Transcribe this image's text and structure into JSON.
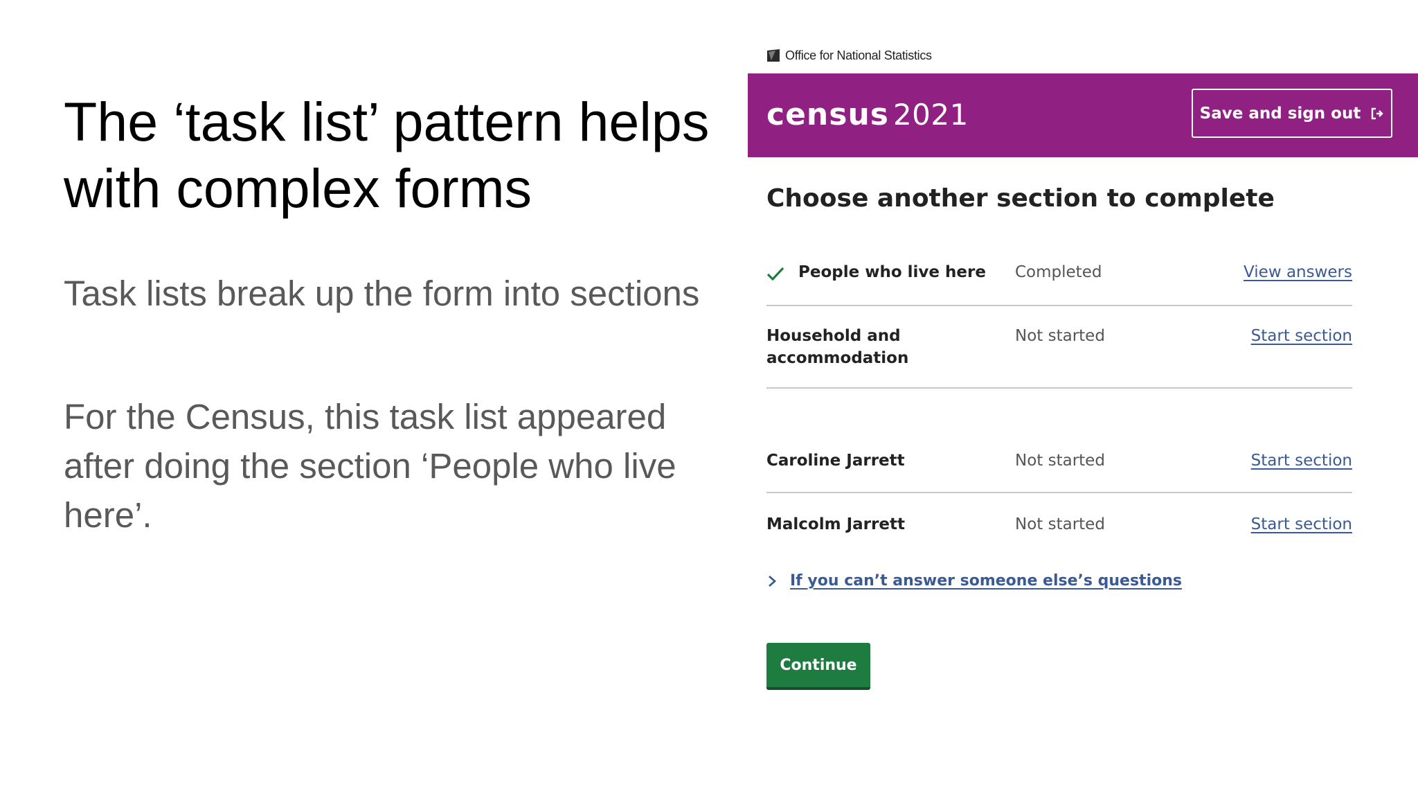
{
  "slide": {
    "title": "The ‘task list’ pattern helps with complex forms",
    "paragraphs": [
      "Task lists break up the form into sections",
      "For the Census, this task list appeared after doing the section ‘People who live here’."
    ]
  },
  "screenshot": {
    "ons_logo_text": "Office for National Statistics",
    "header": {
      "brand_word": "census",
      "brand_year": "2021",
      "save_label": "Save and sign out",
      "background_color": "#902082"
    },
    "heading": "Choose another section to complete",
    "tasks": [
      {
        "name": "People who live here",
        "status": "Completed",
        "action": "View answers",
        "completed": true
      },
      {
        "name": "Household and accommodation",
        "status": "Not started",
        "action": "Start section",
        "completed": false
      },
      {
        "name": "Caroline Jarrett",
        "status": "Not started",
        "action": "Start section",
        "completed": false
      },
      {
        "name": "Malcolm Jarrett",
        "status": "Not started",
        "action": "Start section",
        "completed": false
      }
    ],
    "details_label": "If you can’t answer someone else’s questions",
    "continue_label": "Continue",
    "colors": {
      "link": "#3a5a93",
      "button": "#1e7c41",
      "check": "#1e7c41"
    },
    "icons": [
      "ons-logo-icon",
      "sign-out-icon",
      "check-icon",
      "chevron-right-icon"
    ]
  }
}
